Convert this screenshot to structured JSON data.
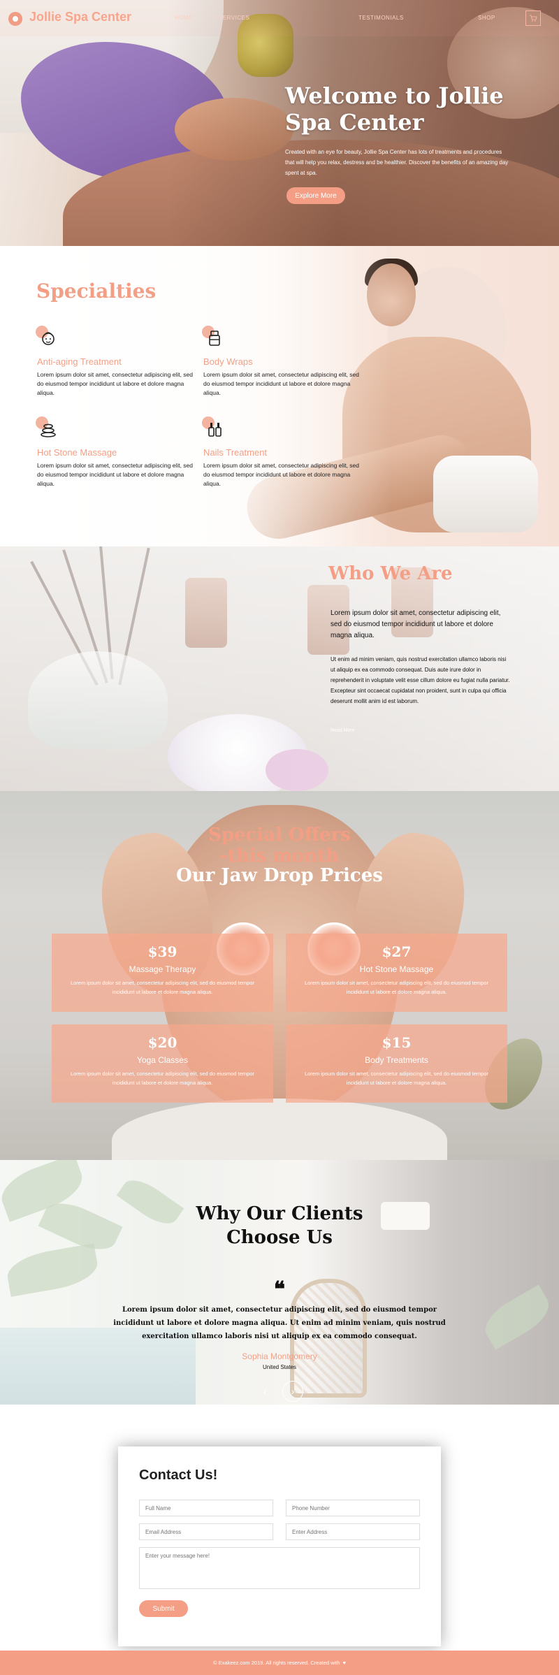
{
  "nav": {
    "logo_text": "Jollie Spa Center",
    "links": [
      "HOME",
      "SERVICES",
      "",
      "",
      "TESTIMONIALS",
      "",
      "SHOP"
    ],
    "cart_icon": "cart-icon"
  },
  "hero": {
    "title": "Welcome to Jollie Spa Center",
    "text": "Created with an eye for beauty, Jollie Spa Center has lots of treatments and procedures that will help you relax, destress and be healthier. Discover the benefits of an amazing day spent at spa.",
    "button": "Explore More"
  },
  "specialties": {
    "title": "Specialties",
    "items": [
      {
        "name": "Anti-aging Treatment",
        "text": "Lorem ipsum dolor sit amet, consectetur adipiscing elit, sed do eiusmod tempor incididunt ut labore et dolore magna aliqua.",
        "icon": "face-mask-icon"
      },
      {
        "name": "Body Wraps",
        "text": "Lorem ipsum dolor sit amet, consectetur adipiscing elit, sed do eiusmod tempor incididunt ut labore et dolore magna aliqua.",
        "icon": "body-wrap-icon"
      },
      {
        "name": "Hot Stone Massage",
        "text": "Lorem ipsum dolor sit amet, consectetur adipiscing elit, sed do eiusmod tempor incididunt ut labore et dolore magna aliqua.",
        "icon": "hot-stones-icon"
      },
      {
        "name": "Nails Treatment",
        "text": "Lorem ipsum dolor sit amet, consectetur adipiscing elit, sed do eiusmod tempor incididunt ut labore et dolore magna aliqua.",
        "icon": "nail-polish-icon"
      }
    ]
  },
  "who": {
    "title": "Who We Are",
    "lead": "Lorem ipsum dolor sit amet, consectetur adipiscing elit, sed do eiusmod tempor incididunt ut labore et dolore magna aliqua.",
    "body": "Ut enim ad minim veniam, quis nostrud exercitation ullamco laboris nisi ut aliquip ex ea commodo consequat. Duis aute irure dolor in reprehenderit in voluptate velit esse cillum dolore eu fugiat nulla pariatur. Excepteur sint occaecat cupidatat non proident, sunt in culpa qui officia deserunt mollit anim id est laborum.",
    "link": "Read More"
  },
  "offers": {
    "title_line1": "Special Offers",
    "title_line2": "-this month",
    "subtitle": "Our Jaw Drop Prices",
    "cards": [
      {
        "price": "$39",
        "name": "Massage Therapy",
        "text": "Lorem ipsum dolor sit amet, consectetur adipiscing elit, sed do eiusmod tempor incididunt ut labore et dolore magna aliqua."
      },
      {
        "price": "$27",
        "name": "Hot Stone Massage",
        "text": "Lorem ipsum dolor sit amet, consectetur adipiscing elit, sed do eiusmod tempor incididunt ut labore et dolore magna aliqua."
      },
      {
        "price": "$20",
        "name": "Yoga Classes",
        "text": "Lorem ipsum dolor sit amet, consectetur adipiscing elit, sed do eiusmod tempor incididunt ut labore et dolore magna aliqua."
      },
      {
        "price": "$15",
        "name": "Body Treatments",
        "text": "Lorem ipsum dolor sit amet, consectetur adipiscing elit, sed do eiusmod tempor incididunt ut labore et dolore magna aliqua."
      }
    ]
  },
  "testimonial": {
    "title_line1": "Why Our Clients",
    "title_line2": "Choose Us",
    "quote_mark": "❝",
    "text": "Lorem ipsum dolor sit amet, consectetur adipiscing elit, sed do eiusmod tempor incididunt ut labore et dolore magna aliqua. Ut enim ad minim veniam, quis nostrud exercitation ullamco laboris nisi ut aliquip ex ea commodo consequat.",
    "name": "Sophia Montgomery",
    "location": "United States",
    "prev": "‹",
    "next": "›"
  },
  "contact": {
    "title": "Contact Us!",
    "full_name_placeholder": "Full Name",
    "phone_placeholder": "Phone Number",
    "email_placeholder": "Email Address",
    "address_placeholder": "Enter Address",
    "message_placeholder": "Enter your message here!",
    "submit": "Submit"
  },
  "footer": {
    "text": "© Exakeez.com 2019. All rights reserved. Created with",
    "heart": "♥"
  },
  "colors": {
    "accent": "#f49f85",
    "dark": "#111111",
    "white": "#ffffff"
  }
}
